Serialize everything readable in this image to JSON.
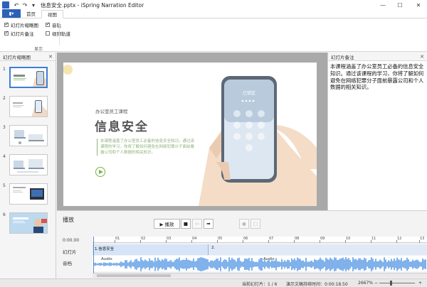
{
  "window": {
    "title": "信息安全.pptx - iSpring Narration Editor",
    "undo_glyph": "↶",
    "redo_glyph": "↷",
    "qat_dropdown_glyph": "▾",
    "minimize_glyph": "—",
    "maximize_glyph": "☐",
    "close_glyph": "✕"
  },
  "ribbon": {
    "file_label": "▮▾",
    "tabs": [
      {
        "label": "首页",
        "active": false
      },
      {
        "label": "视图",
        "active": true
      }
    ],
    "checkboxes": [
      {
        "label": "幻灯片缩略图",
        "checked": true
      },
      {
        "label": "幻灯片备注",
        "checked": true
      },
      {
        "label": "音轨",
        "checked": true
      },
      {
        "label": "视频轨道",
        "checked": false
      }
    ],
    "group_label": "显示"
  },
  "slides_panel": {
    "title": "幻灯片缩略图",
    "close_glyph": "✕",
    "thumbnails": [
      {
        "number": "1",
        "selected": true
      },
      {
        "number": "2",
        "selected": false
      },
      {
        "number": "3",
        "selected": false
      },
      {
        "number": "4",
        "selected": false
      },
      {
        "number": "5",
        "selected": false
      },
      {
        "number": "6",
        "selected": false
      }
    ]
  },
  "slide": {
    "subtitle": "办公室员工课程",
    "title": "信息安全",
    "body": "本课程涵盖了办公室员工必备的信息安全知识。通过该课程的学习，你将了解如何避免在网络犯罪分子面前暴露公司和个人数据的相关知识。",
    "phone_lock_text": "已锁定"
  },
  "notes_panel": {
    "title": "幻灯片备注",
    "close_glyph": "✕",
    "text": "本课程涵盖了办公室员工必备的信息安全知识。通过该课程的学习，你将了解如何避免在网络犯罪分子面前暴露公司和个人数据的相关知识。"
  },
  "playback": {
    "label": "播放",
    "play_label": "▶ 播放",
    "stop_glyph": "■",
    "prev_glyph": "⇦",
    "next_glyph": "➡",
    "record_glyph": "●",
    "square_glyph": "□",
    "time_start": "0:00.00",
    "ticks": [
      "01",
      "02",
      "03",
      "04",
      "05",
      "06",
      "07",
      "08",
      "09",
      "10",
      "11",
      "12",
      "13"
    ],
    "slides_row_label": "幻灯片",
    "audio_row_label": "音档",
    "segments": [
      {
        "label": "1.信息安全"
      },
      {
        "label": "2."
      }
    ],
    "audio_labels": [
      "Audio",
      "Audio"
    ]
  },
  "statusbar": {
    "current_slide": "当前幻灯片：1 / 6",
    "duration": "演示文稿持续时间：0:00:18.50",
    "zoom": "2667%",
    "zoom_minus": "−",
    "zoom_plus": "+"
  },
  "colors": {
    "accent": "#2b62b8",
    "selection": "#3c7fd6",
    "waveform": "#4a90e2",
    "slide_green": "#7ab34a"
  }
}
